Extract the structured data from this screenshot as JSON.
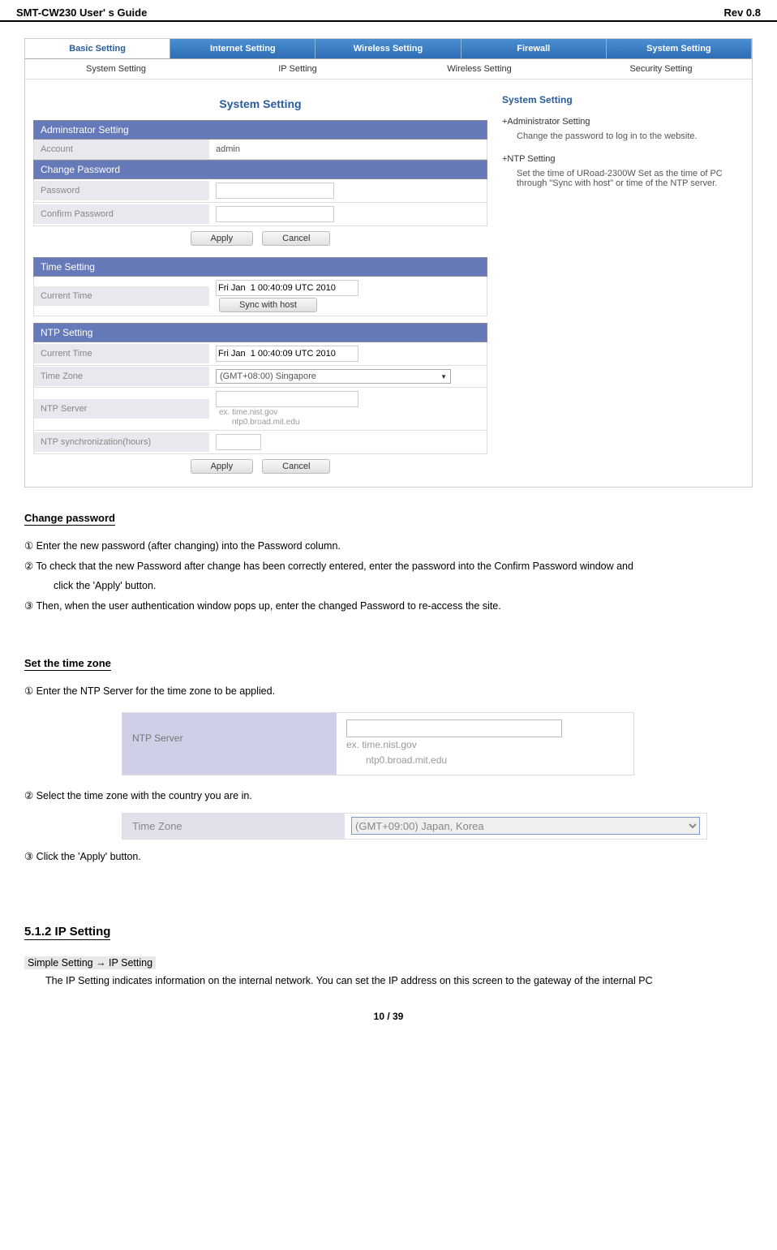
{
  "header": {
    "left": "SMT-CW230 User' s Guide",
    "right": "Rev 0.8"
  },
  "router": {
    "tabs_primary": [
      "Basic Setting",
      "Internet Setting",
      "Wireless Setting",
      "Firewall",
      "System Setting"
    ],
    "tabs_secondary": [
      "System Setting",
      "IP Setting",
      "Wireless Setting",
      "Security Setting"
    ],
    "panel_title": "System Setting",
    "admin_header": "Adminstrator Setting",
    "account_label": "Account",
    "account_value": "admin",
    "change_pw_header": "Change Password",
    "password_label": "Password",
    "confirm_label": "Confirm Password",
    "apply_label": "Apply",
    "cancel_label": "Cancel",
    "time_header": "Time Setting",
    "current_time_label": "Current Time",
    "current_time_value": "Fri Jan  1 00:40:09 UTC 2010",
    "sync_label": "Sync with host",
    "ntp_header": "NTP Setting",
    "ntp_time_label": "Current Time",
    "ntp_time_value": "Fri Jan  1 00:40:09 UTC 2010",
    "tz_label": "Time Zone",
    "tz_value": "(GMT+08:00) Singapore",
    "ntp_server_label": "NTP Server",
    "ntp_hint1": "ex. time.nist.gov",
    "ntp_hint2": "ntp0.broad.mit.edu",
    "ntp_sync_label": "NTP synchronization(hours)",
    "right_title": "System Setting",
    "right_sub1": "+Administrator Setting",
    "right_desc1": "Change the password to log in to the website.",
    "right_sub2": "+NTP Setting",
    "right_desc2": "Set the time of URoad-2300W Set as the time of PC through \"Sync with host\" or time of the NTP server."
  },
  "doc": {
    "change_pw_heading": "Change password",
    "cp_step1": "①  Enter the new password (after changing) into the Password column.",
    "cp_step2a": "② To check that the new Password after change has been correctly entered, enter the password into the Confirm Password window and",
    "cp_step2b": "click the  'Apply'  button.",
    "cp_step3": "③  Then, when the user authentication window pops up, enter the changed Password to re-access the site.",
    "tz_heading": "Set the time zone",
    "tz_step1": "①  Enter the NTP Server for the time zone to be applied.",
    "ntp_shot_label": "NTP Server",
    "ntp_shot_hint1": "ex. time.nist.gov",
    "ntp_shot_hint2": "ntp0.broad.mit.edu",
    "tz_step2": "②  Select the time zone with the country you are in.",
    "tz_shot_label": "Time Zone",
    "tz_shot_value": "(GMT+09:00) Japan, Korea",
    "tz_step3": "③  Click the  'Apply'  button.",
    "ip_heading": "5.1.2 IP Setting",
    "ip_path": "Simple Setting → IP Setting",
    "ip_para": "The IP Setting indicates information on the internal network. You can set the IP address on this screen to the gateway of the internal PC"
  },
  "footer": "10 / 39"
}
